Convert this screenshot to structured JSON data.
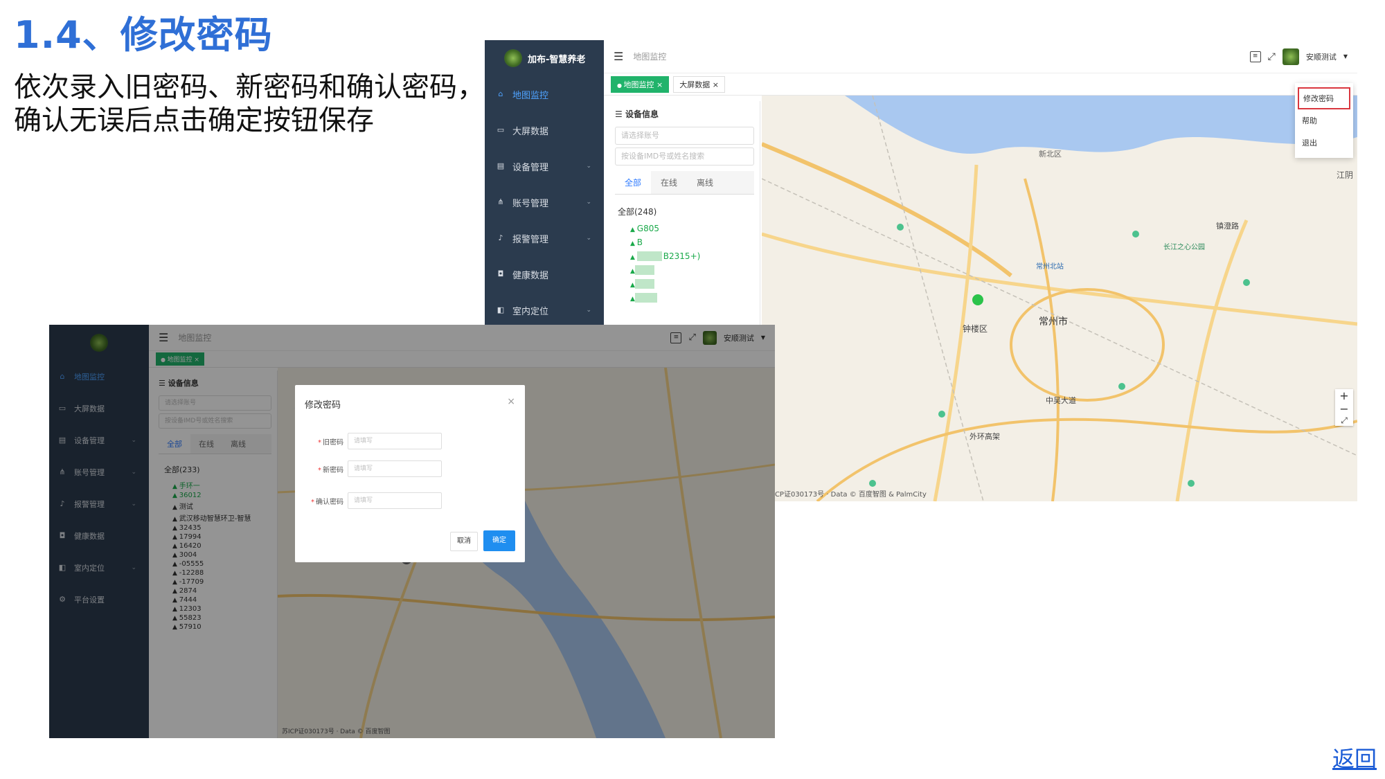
{
  "slide": {
    "title": "1.4、修改密码",
    "desc_line1": "依次录入旧密码、新密码和确认密码，",
    "desc_line2": "确认无误后点击确定按钮保存",
    "back_label": "返回"
  },
  "shot1": {
    "brand": "加布-智慧养老",
    "menu": [
      {
        "label": "地图监控",
        "icon": "home-icon",
        "active": true
      },
      {
        "label": "大屏数据",
        "icon": "screen-icon"
      },
      {
        "label": "设备管理",
        "icon": "device-icon",
        "caret": true
      },
      {
        "label": "账号管理",
        "icon": "user-tree-icon",
        "caret": true
      },
      {
        "label": "报警管理",
        "icon": "bell-icon",
        "caret": true
      },
      {
        "label": "健康数据",
        "icon": "heart-icon"
      },
      {
        "label": "室内定位",
        "icon": "location-icon",
        "caret": true
      }
    ],
    "breadcrumb": "地图监控",
    "user": "安顺测试",
    "tabs": [
      "地图监控",
      "大屏数据"
    ],
    "panel_title": "设备信息",
    "select_placeholder": "请选择账号",
    "search_placeholder": "按设备IMD号或姓名搜索",
    "seg_tabs": [
      "全部",
      "在线",
      "离线"
    ],
    "tree_root": "全部(248)",
    "devices": [
      "G805",
      "B",
      "",
      "",
      "",
      ""
    ],
    "device3_suffix": "B2315+)",
    "dropdown": [
      "修改密码",
      "帮助",
      "退出"
    ],
    "map_city": "常州市",
    "map_footer": "苏ICP证030173号 · Data © 百度智图 & PalmCity",
    "map_labels": [
      "江阴",
      "钟楼区",
      "新北区",
      "中吴大道",
      "外环高架",
      "镇澄路",
      "长江之心公园",
      "常州北站"
    ]
  },
  "shot2": {
    "menu": [
      {
        "label": "地图监控",
        "icon": "home-icon",
        "active": true
      },
      {
        "label": "大屏数据",
        "icon": "screen-icon"
      },
      {
        "label": "设备管理",
        "icon": "device-icon",
        "caret": true
      },
      {
        "label": "账号管理",
        "icon": "user-tree-icon",
        "caret": true
      },
      {
        "label": "报警管理",
        "icon": "bell-icon",
        "caret": true
      },
      {
        "label": "健康数据",
        "icon": "heart-icon"
      },
      {
        "label": "室内定位",
        "icon": "location-icon",
        "caret": true
      },
      {
        "label": "平台设置",
        "icon": "gear-icon"
      }
    ],
    "breadcrumb": "地图监控",
    "user": "安顺测试",
    "tab": "地图监控",
    "panel_title": "设备信息",
    "select_placeholder": "请选择账号",
    "search_placeholder": "按设备IMD号或姓名搜索",
    "seg_tabs": [
      "全部",
      "在线",
      "离线"
    ],
    "tree_root": "全部(233)",
    "devices_green": [
      "手环一",
      "36012"
    ],
    "devices": [
      "测试",
      "武汉移动智慧环卫-智慧",
      "32435",
      "17994",
      "16420",
      "3004",
      "-05555",
      "-12288",
      "-17709",
      "2874",
      "7444",
      "12303",
      "55823",
      "57910"
    ],
    "map_footer": "苏ICP证030173号 · Data © 百度智图",
    "modal": {
      "title": "修改密码",
      "old_label": "旧密码",
      "new_label": "新密码",
      "confirm_label": "确认密码",
      "placeholder": "请填写",
      "cancel": "取消",
      "ok": "确定"
    }
  }
}
